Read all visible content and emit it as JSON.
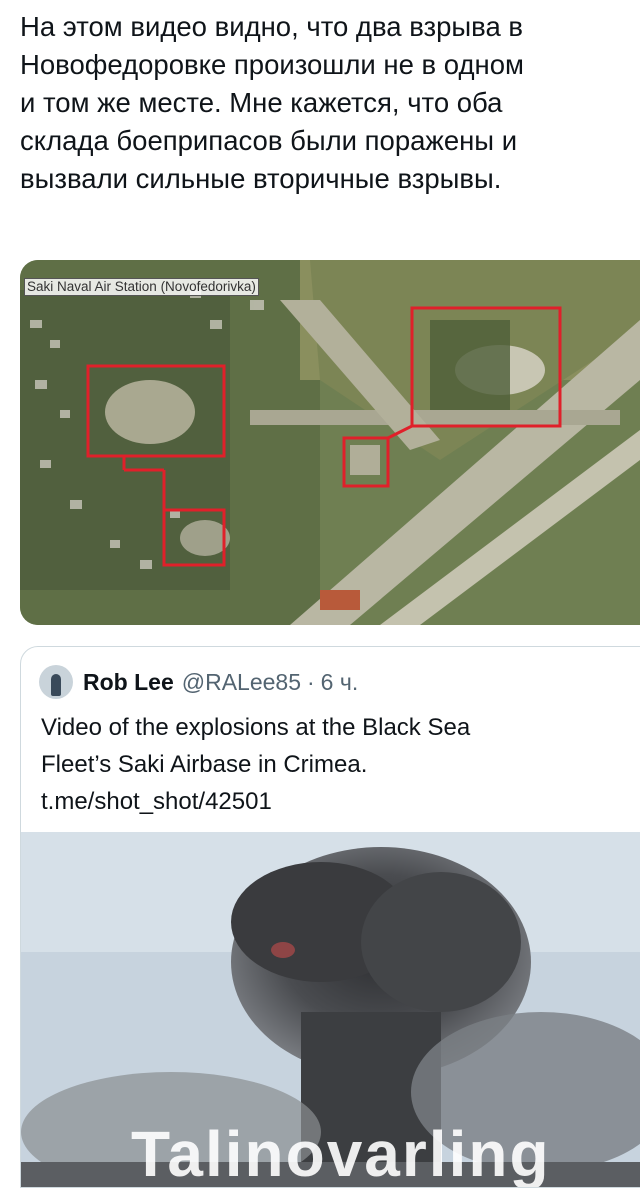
{
  "post": {
    "lines": [
      "На этом видео видно, что два взрыва в",
      "Новофедоровке произошли не в одном",
      "и том же месте. Мне кажется, что оба",
      "склада боеприпасов были поражены и",
      "вызвали сильные вторичные взрывы."
    ]
  },
  "satellite": {
    "caption": "Saki Naval Air Station (Novofedorivka)",
    "highlight_color": "#e0202a"
  },
  "quote": {
    "author_name": "Rob Lee",
    "handle": "@RALee85",
    "separator": "·",
    "time": "6 ч.",
    "text_lines": [
      "Video of the explosions at the Black Sea",
      "Fleet’s Saki Airbase in Crimea.",
      "t.me/shot_shot/42501"
    ],
    "video_subtitle": "Talinovarling"
  },
  "colors": {
    "text": "#0f1419",
    "secondary": "#536471",
    "border": "#cfd9de"
  }
}
